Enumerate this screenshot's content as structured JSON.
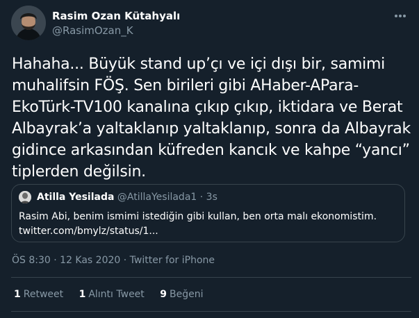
{
  "author": {
    "name": "Rasim Ozan Kütahyalı",
    "handle": "@RasimOzan_K"
  },
  "tweet_text": "Hahaha... Büyük stand up’çı ve içi dışı bir, samimi muhalifsin FÖŞ. Sen birileri gibi AHaber-APara-EkoTürk-TV100 kanalına çıkıp çıkıp, iktidara ve Berat Albayrak’a yaltaklanıp yaltaklanıp, sonra da Albayrak gidince arkasından küfreden kancık ve kahpe “yancı” tiplerden değilsin.",
  "quoted_tweet": {
    "name": "Atilla Yesilada",
    "handle": "@AtillaYesilada1",
    "separator": "·",
    "time": "3s",
    "text_line1": "Rasim Abi, benim ismimi istediğin gibi kullan, ben orta malı ekonomistim.",
    "text_line2": "twitter.com/bmylz/status/1..."
  },
  "meta": {
    "time": "ÖS 8:30",
    "date": "12 Kas 2020",
    "source": "Twitter for iPhone",
    "separator": "·"
  },
  "stats": {
    "retweets_count": "1",
    "retweets_label": "Retweet",
    "quotes_count": "1",
    "quotes_label": "Alıntı Tweet",
    "likes_count": "9",
    "likes_label": "Beğeni"
  },
  "colors": {
    "background": "#15202b",
    "text": "#ffffff",
    "secondary_text": "#8899a6",
    "border": "#38444d"
  },
  "icons": {
    "more": "more-dots-icon"
  }
}
